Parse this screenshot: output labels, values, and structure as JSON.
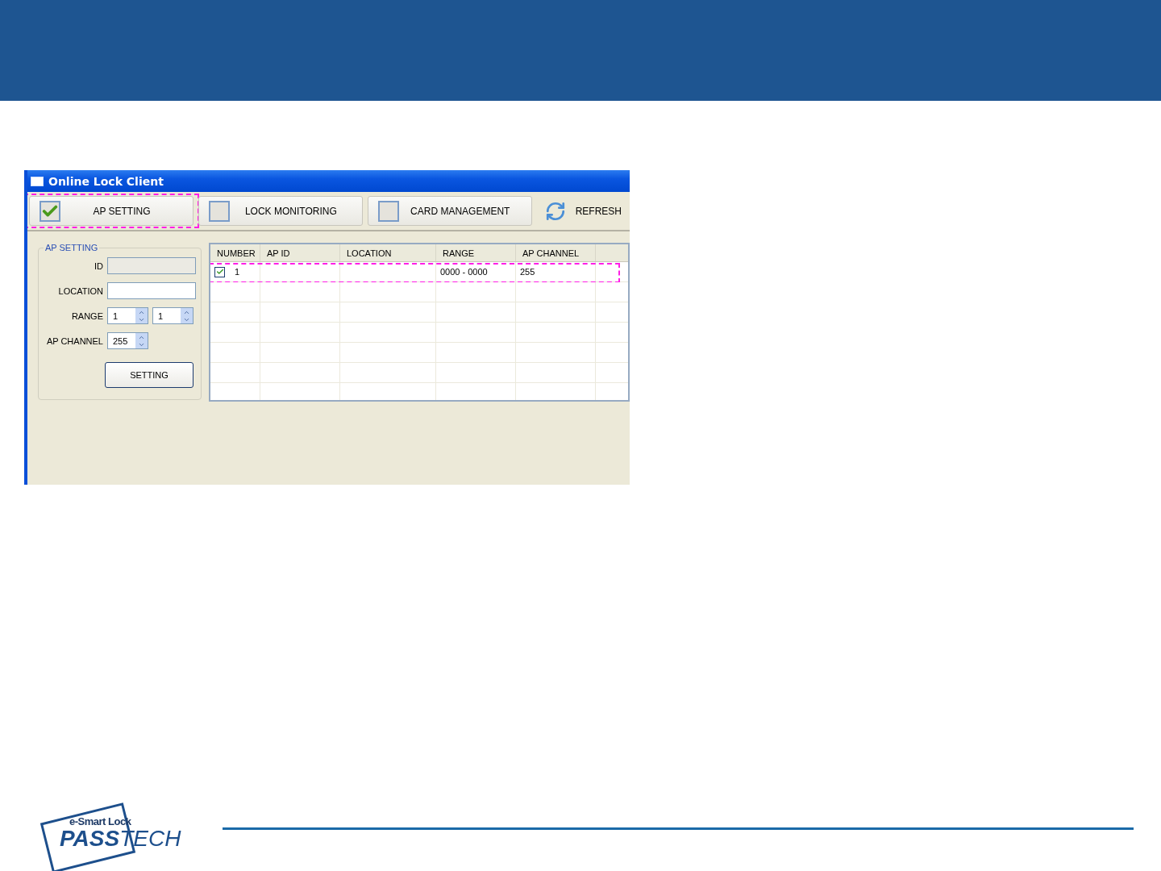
{
  "window": {
    "title": "Online Lock Client"
  },
  "toolbar": {
    "tabs": [
      {
        "label": "AP SETTING",
        "checked": true,
        "highlighted": true
      },
      {
        "label": "LOCK MONITORING",
        "checked": false,
        "highlighted": false
      },
      {
        "label": "CARD MANAGEMENT",
        "checked": false,
        "highlighted": false
      }
    ],
    "refresh": {
      "label": "REFRESH"
    }
  },
  "form": {
    "title": "AP SETTING",
    "id": {
      "label": "ID",
      "disabled": true
    },
    "location": {
      "label": "LOCATION",
      "disabled": false
    },
    "range": {
      "label": "RANGE",
      "from": "1",
      "to": "1"
    },
    "channel": {
      "label": "AP CHANNEL",
      "value": "255"
    },
    "button": "SETTING"
  },
  "table": {
    "columns": [
      "NUMBER",
      "AP ID",
      "LOCATION",
      "RANGE",
      "AP CHANNEL"
    ],
    "rows": [
      {
        "checked": true,
        "highlighted": true,
        "cells": [
          "1",
          "",
          "",
          "0000 - 0000",
          "255"
        ]
      }
    ]
  },
  "logo": {
    "tagline": "e-Smart Lock",
    "name": "**PASS**TECH"
  }
}
